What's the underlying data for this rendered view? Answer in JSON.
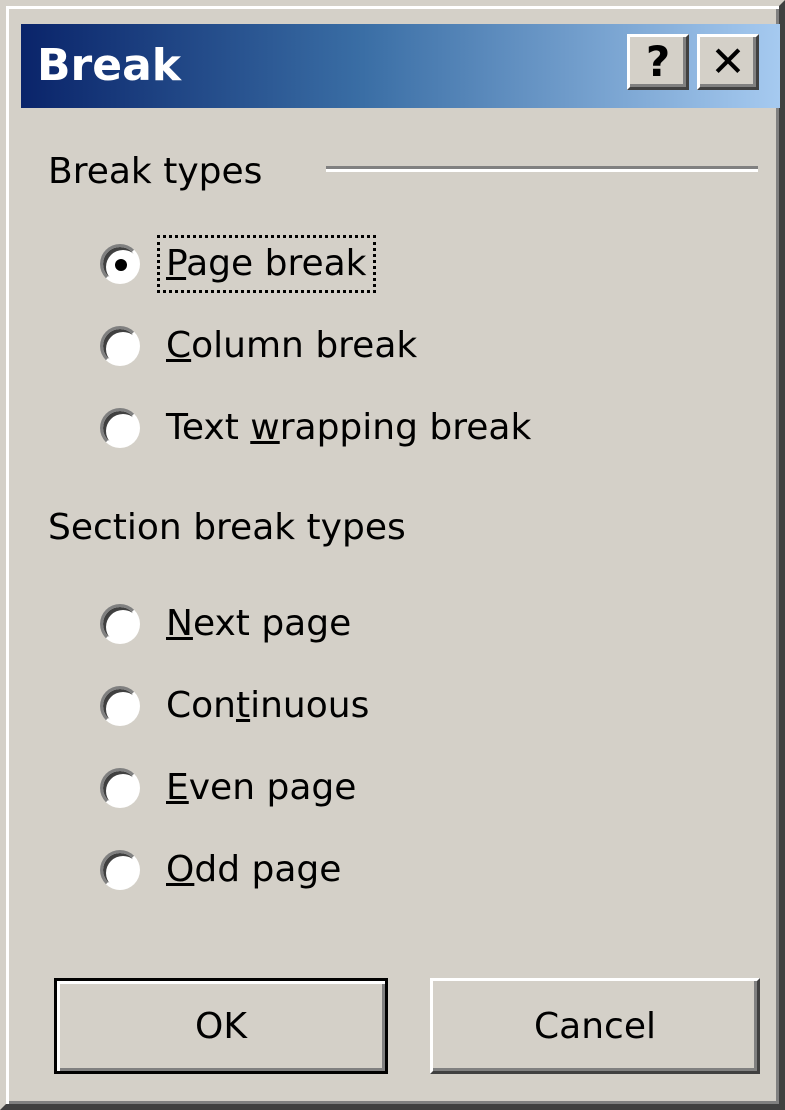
{
  "window": {
    "title": "Break",
    "help_glyph": "?",
    "close_glyph": "✕",
    "help_icon": "question-mark-icon",
    "close_icon": "close-icon"
  },
  "break_types": {
    "label": "Break types",
    "options": [
      {
        "before": "",
        "accel": "P",
        "after": "age break",
        "checked": true,
        "focused": true
      },
      {
        "before": "",
        "accel": "C",
        "after": "olumn break",
        "checked": false,
        "focused": false
      },
      {
        "before": "Text ",
        "accel": "w",
        "after": "rapping break",
        "checked": false,
        "focused": false
      }
    ]
  },
  "section_break_types": {
    "label": "Section break types",
    "options": [
      {
        "before": "",
        "accel": "N",
        "after": "ext page",
        "checked": false
      },
      {
        "before": "Con",
        "accel": "t",
        "after": "inuous",
        "checked": false
      },
      {
        "before": "",
        "accel": "E",
        "after": "ven page",
        "checked": false
      },
      {
        "before": "",
        "accel": "O",
        "after": "dd page",
        "checked": false
      }
    ]
  },
  "buttons": {
    "ok": "OK",
    "cancel": "Cancel"
  },
  "colors": {
    "face": "#d4d0c8",
    "title_start": "#0a246a",
    "title_end": "#a6caf0"
  }
}
